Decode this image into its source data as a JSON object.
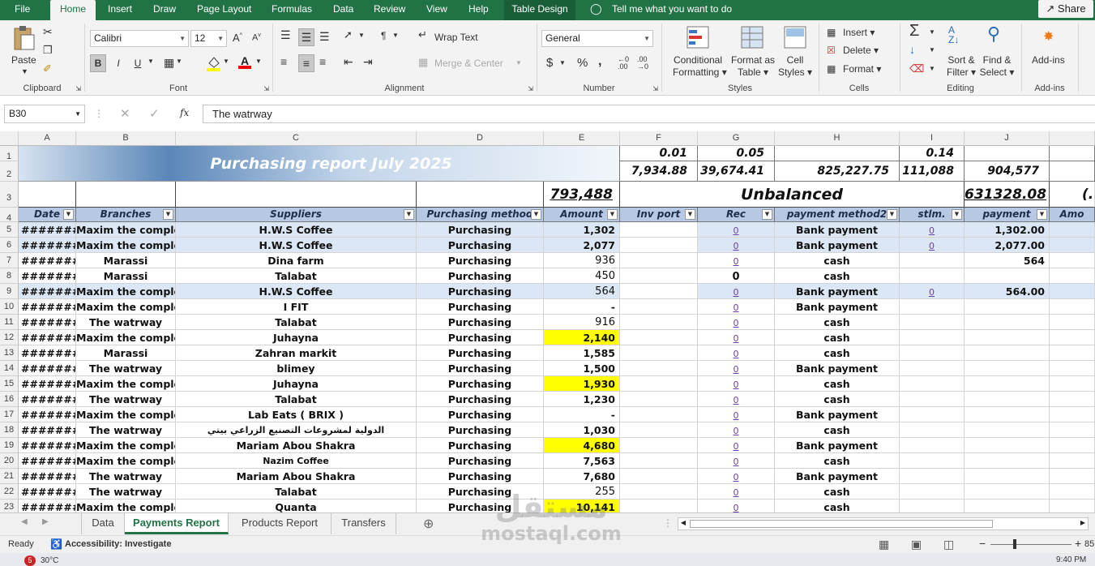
{
  "menu": {
    "tabs": [
      "File",
      "Home",
      "Insert",
      "Draw",
      "Page Layout",
      "Formulas",
      "Data",
      "Review",
      "View",
      "Help",
      "Table Design"
    ],
    "tell_me": "Tell me what you want to do",
    "share": "Share"
  },
  "ribbon": {
    "clipboard": {
      "paste": "Paste",
      "label": "Clipboard"
    },
    "font": {
      "name": "Calibri",
      "size": "12",
      "bold": "B",
      "italic": "I",
      "underline": "U",
      "label": "Font"
    },
    "alignment": {
      "wrap": "Wrap Text",
      "merge": "Merge & Center",
      "label": "Alignment"
    },
    "number": {
      "format": "General",
      "currency": "$",
      "percent": "%",
      "comma": ",",
      "label": "Number"
    },
    "styles": {
      "conditional": "Conditional",
      "conditional2": "Formatting",
      "format_as": "Format as",
      "format_as2": "Table",
      "cell": "Cell",
      "cell2": "Styles",
      "label": "Styles"
    },
    "cells": {
      "insert": "Insert",
      "delete": "Delete",
      "format": "Format",
      "label": "Cells"
    },
    "editing": {
      "sort": "Sort &",
      "sort2": "Filter",
      "find": "Find &",
      "find2": "Select",
      "label": "Editing"
    },
    "addins": {
      "btn": "Add-ins",
      "label": "Add-ins"
    }
  },
  "formula_bar": {
    "name_box": "B30",
    "fx": "fx",
    "content": "The watrway"
  },
  "columns": [
    "A",
    "B",
    "C",
    "D",
    "E",
    "F",
    "G",
    "H",
    "I",
    "J"
  ],
  "top": {
    "title": "Purchasing report July 2025",
    "F1": "0.01",
    "G1": "0.05",
    "I1": "0.14",
    "F2": "7,934.88",
    "G2": "39,674.41",
    "H2": "825,227.75",
    "I2": "111,088",
    "J2": "904,577",
    "E3": "793,488",
    "FH3": "Unbalanced",
    "J3": "631328.08",
    "K3": "(."
  },
  "headers": [
    "Date",
    "Branches",
    "Suppliers",
    "Purchasing method",
    "Amount",
    "Inv port",
    "Rec",
    "payment method2",
    "stlm.",
    "payment",
    "Amo"
  ],
  "rows": [
    {
      "n": "5",
      "date": "#########",
      "branch": "Maxim the complex",
      "supplier": "H.W.S Coffee",
      "method": "Purchasing",
      "amount": "1,302",
      "rec": "0",
      "pm": "Bank payment",
      "stlm": "0",
      "pay": "1,302.00",
      "blue": true
    },
    {
      "n": "6",
      "date": "#########",
      "branch": "Maxim the complex",
      "supplier": "H.W.S Coffee",
      "method": "Purchasing",
      "amount": "2,077",
      "rec": "0",
      "pm": "Bank payment",
      "stlm": "0",
      "pay": "2,077.00",
      "blue": true
    },
    {
      "n": "7",
      "date": "#########",
      "branch": "Marassi",
      "supplier": "Dina farm",
      "method": "Purchasing",
      "amount": "936",
      "rec": "0",
      "pm": "cash",
      "stlm": "",
      "pay": "564"
    },
    {
      "n": "8",
      "date": "#########",
      "branch": "Marassi",
      "supplier": "Talabat",
      "method": "Purchasing",
      "amount": "450",
      "rec": "0",
      "pm": "cash",
      "stlm": "",
      "pay": "",
      "recbold": true
    },
    {
      "n": "9",
      "date": "#########",
      "branch": "Maxim the complex",
      "supplier": "H.W.S Coffee",
      "method": "Purchasing",
      "amount": "564",
      "rec": "0",
      "pm": "Bank payment",
      "stlm": "0",
      "pay": "564.00",
      "blue": true
    },
    {
      "n": "10",
      "date": "#########",
      "branch": "Maxim the complex",
      "supplier": "I FIT",
      "method": "Purchasing",
      "amount": "-",
      "rec": "0",
      "pm": "Bank payment",
      "stlm": "",
      "pay": ""
    },
    {
      "n": "11",
      "date": "#########",
      "branch": "The watrway",
      "supplier": "Talabat",
      "method": "Purchasing",
      "amount": "916",
      "rec": "0",
      "pm": "cash",
      "stlm": "",
      "pay": ""
    },
    {
      "n": "12",
      "date": "#########",
      "branch": "Maxim the complex",
      "supplier": "Juhayna",
      "method": "Purchasing",
      "amount": "2,140",
      "rec": "0",
      "pm": "cash",
      "stlm": "",
      "pay": "",
      "yellow": true
    },
    {
      "n": "13",
      "date": "#########",
      "branch": "Marassi",
      "supplier": "Zahran markit",
      "method": "Purchasing",
      "amount": "1,585",
      "rec": "0",
      "pm": "cash",
      "stlm": "",
      "pay": ""
    },
    {
      "n": "14",
      "date": "#########",
      "branch": "The watrway",
      "supplier": "blimey",
      "method": "Purchasing",
      "amount": "1,500",
      "rec": "0",
      "pm": "Bank payment",
      "stlm": "",
      "pay": ""
    },
    {
      "n": "15",
      "date": "#########",
      "branch": "Maxim the complex",
      "supplier": "Juhayna",
      "method": "Purchasing",
      "amount": "1,930",
      "rec": "0",
      "pm": "cash",
      "stlm": "",
      "pay": "",
      "yellow": true
    },
    {
      "n": "16",
      "date": "#########",
      "branch": "The watrway",
      "supplier": "Talabat",
      "method": "Purchasing",
      "amount": "1,230",
      "rec": "0",
      "pm": "cash",
      "stlm": "",
      "pay": ""
    },
    {
      "n": "17",
      "date": "#########",
      "branch": "Maxim the complex",
      "supplier": "Lab Eats ( BRIX )",
      "method": "Purchasing",
      "amount": "-",
      "rec": "0",
      "pm": "Bank payment",
      "stlm": "",
      "pay": ""
    },
    {
      "n": "18",
      "date": "#########",
      "branch": "The watrway",
      "supplier": "الدولية لمشروعات التصنيع الزراعي بيتي",
      "method": "Purchasing",
      "amount": "1,030",
      "rec": "0",
      "pm": "cash",
      "stlm": "",
      "pay": "",
      "small": true
    },
    {
      "n": "19",
      "date": "#########",
      "branch": "Maxim the complex",
      "supplier": "Mariam Abou Shakra",
      "method": "Purchasing",
      "amount": "4,680",
      "rec": "0",
      "pm": "Bank payment",
      "stlm": "",
      "pay": "",
      "yellow": true
    },
    {
      "n": "20",
      "date": "#########",
      "branch": "Maxim the complex",
      "supplier": "Nazim Coffee",
      "method": "Purchasing",
      "amount": "7,563",
      "rec": "0",
      "pm": "cash",
      "stlm": "",
      "pay": "",
      "small": true
    },
    {
      "n": "21",
      "date": "#########",
      "branch": "The watrway",
      "supplier": "Mariam Abou Shakra",
      "method": "Purchasing",
      "amount": "7,680",
      "rec": "0",
      "pm": "Bank payment",
      "stlm": "",
      "pay": ""
    },
    {
      "n": "22",
      "date": "#########",
      "branch": "The watrway",
      "supplier": "Talabat",
      "method": "Purchasing",
      "amount": "255",
      "rec": "0",
      "pm": "cash",
      "stlm": "",
      "pay": ""
    },
    {
      "n": "23",
      "date": "#########",
      "branch": "Maxim the complex",
      "supplier": "Quanta",
      "method": "Purchasing",
      "amount": "10,141",
      "rec": "0",
      "pm": "cash",
      "stlm": "",
      "pay": "",
      "yellow": true
    }
  ],
  "row_numbers_top": [
    "1",
    "2",
    "3",
    "4"
  ],
  "sheets": [
    "Data",
    "Payments Report",
    "Products Report",
    "Transfers"
  ],
  "status": {
    "ready": "Ready",
    "accessibility": "Accessibility: Investigate",
    "zoom": "85"
  },
  "taskbar": {
    "temp": "30°C",
    "time": "9:40 PM",
    "badge": "5"
  },
  "watermark": {
    "arabic": "مستقل",
    "latin": "mostaql.com"
  }
}
